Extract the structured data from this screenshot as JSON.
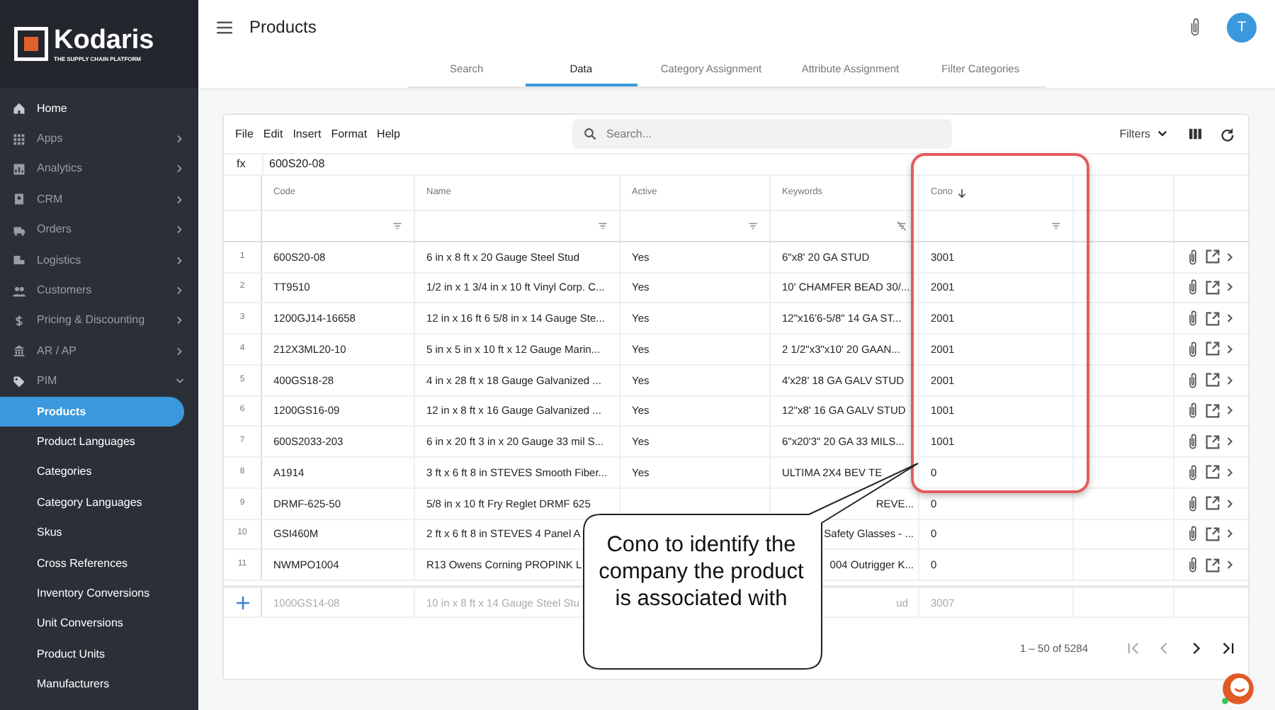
{
  "sidebar": {
    "logo": {
      "name": "Kodaris",
      "tagline": "THE SUPPLY CHAIN PLATFORM"
    },
    "items": [
      {
        "label": "Home",
        "kind": "link"
      },
      {
        "label": "Apps",
        "kind": "group",
        "expanded": false
      },
      {
        "label": "Analytics",
        "kind": "group",
        "expanded": false
      },
      {
        "label": "CRM",
        "kind": "group",
        "expanded": false
      },
      {
        "label": "Orders",
        "kind": "group",
        "expanded": false
      },
      {
        "label": "Logistics",
        "kind": "group",
        "expanded": false
      },
      {
        "label": "Customers",
        "kind": "group",
        "expanded": false
      },
      {
        "label": "Pricing & Discounting",
        "kind": "group",
        "expanded": false
      },
      {
        "label": "AR / AP",
        "kind": "group",
        "expanded": false
      },
      {
        "label": "PIM",
        "kind": "group",
        "expanded": true,
        "children": [
          {
            "label": "Products",
            "selected": true
          },
          {
            "label": "Product Languages",
            "selected": false
          },
          {
            "label": "Categories",
            "selected": false
          },
          {
            "label": "Category Languages",
            "selected": false
          },
          {
            "label": "Skus",
            "selected": false
          },
          {
            "label": "Cross References",
            "selected": false
          },
          {
            "label": "Inventory Conversions",
            "selected": false
          },
          {
            "label": "Unit Conversions",
            "selected": false
          },
          {
            "label": "Product Units",
            "selected": false
          },
          {
            "label": "Manufacturers",
            "selected": false
          }
        ]
      }
    ]
  },
  "header": {
    "title": "Products",
    "avatar": "T"
  },
  "tabs": [
    {
      "label": "Search",
      "selected": false
    },
    {
      "label": "Data",
      "selected": true
    },
    {
      "label": "Category Assignment",
      "selected": false
    },
    {
      "label": "Attribute Assignment",
      "selected": false
    },
    {
      "label": "Filter Categories",
      "selected": false
    }
  ],
  "toolbar": {
    "menu": [
      "File",
      "Edit",
      "Insert",
      "Format",
      "Help"
    ],
    "search": {
      "placeholder": "Search..."
    },
    "filters": "Filters"
  },
  "formula_bar": {
    "label": "fx",
    "value": "600S20-08"
  },
  "table": {
    "columns": [
      {
        "label": "Code",
        "sorted": false,
        "filtered": false
      },
      {
        "label": "Name",
        "sorted": false,
        "filtered": false
      },
      {
        "label": "Active",
        "sorted": false,
        "filtered": false
      },
      {
        "label": "Keywords",
        "sorted": false,
        "filtered": true
      },
      {
        "label": "Cono",
        "sorted": true,
        "filtered": false
      }
    ],
    "rows": [
      {
        "number": "1",
        "code": "600S20-08",
        "name": "6 in x 8 ft x 20 Gauge Steel Stud",
        "active": "Yes",
        "keywords": "6\"x8' 20 GA STUD",
        "cono": "3001"
      },
      {
        "number": "2",
        "code": "TT9510",
        "name": "1/2 in x 1 3/4 in x 10 ft Vinyl Corp. C...",
        "active": "Yes",
        "keywords": "10' CHAMFER BEAD 30/...",
        "cono": "2001"
      },
      {
        "number": "3",
        "code": "1200GJ14-16658",
        "name": "12 in x 16 ft 6 5/8 in x 14 Gauge Ste...",
        "active": "Yes",
        "keywords": "12\"x16'6-5/8\" 14 GA ST...",
        "cono": "2001"
      },
      {
        "number": "4",
        "code": "212X3ML20-10",
        "name": "5 in x 5 in x 10 ft x 12 Gauge Marin...",
        "active": "Yes",
        "keywords": "2 1/2\"x3\"x10' 20 GAAN...",
        "cono": "2001"
      },
      {
        "number": "5",
        "code": "400GS18-28",
        "name": "4 in x 28 ft x 18 Gauge Galvanized ...",
        "active": "Yes",
        "keywords": "4'x28' 18 GA GALV STUD",
        "cono": "2001"
      },
      {
        "number": "6",
        "code": "1200GS16-09",
        "name": "12 in x 8 ft x 16 Gauge Galvanized ...",
        "active": "Yes",
        "keywords": "12\"x8' 16 GA GALV STUD",
        "cono": "1001"
      },
      {
        "number": "7",
        "code": "600S2033-203",
        "name": "6 in x 20 ft 3 in x 20 Gauge 33 mil S...",
        "active": "Yes",
        "keywords": "6\"x20'3\" 20 GA 33 MILS...",
        "cono": "1001"
      },
      {
        "number": "8",
        "code": "A1914",
        "name": "3 ft x 6 ft 8 in STEVES Smooth Fiber...",
        "active": "Yes",
        "keywords": "ULTIMA 2X4 BEV TE",
        "cono": "0"
      },
      {
        "number": "9",
        "code": "DRMF-625-50",
        "name": "5/8 in x 10 ft Fry Reglet DRMF 625",
        "keywords": "REVE...",
        "cono": "0"
      },
      {
        "number": "10",
        "code": "GSI460M",
        "name": "2 ft x 6 ft 8 in STEVES 4 Panel A",
        "keywords": "Safety Glasses - ...",
        "cono": "0"
      },
      {
        "number": "11",
        "code": "NWMPO1004",
        "name": "R13 Owens Corning PROPINK L",
        "keywords": "004 Outrigger K...",
        "cono": "0"
      }
    ],
    "new_row": {
      "code": "1000GS14-08",
      "name": "10 in x 8 ft x 14 Gauge Steel Stu",
      "keywords": "ud",
      "cono": "3007"
    }
  },
  "pagination": {
    "range": "1 – 50 of 5284"
  },
  "callout": {
    "text": "Cono to identify the company the product is associated with"
  }
}
